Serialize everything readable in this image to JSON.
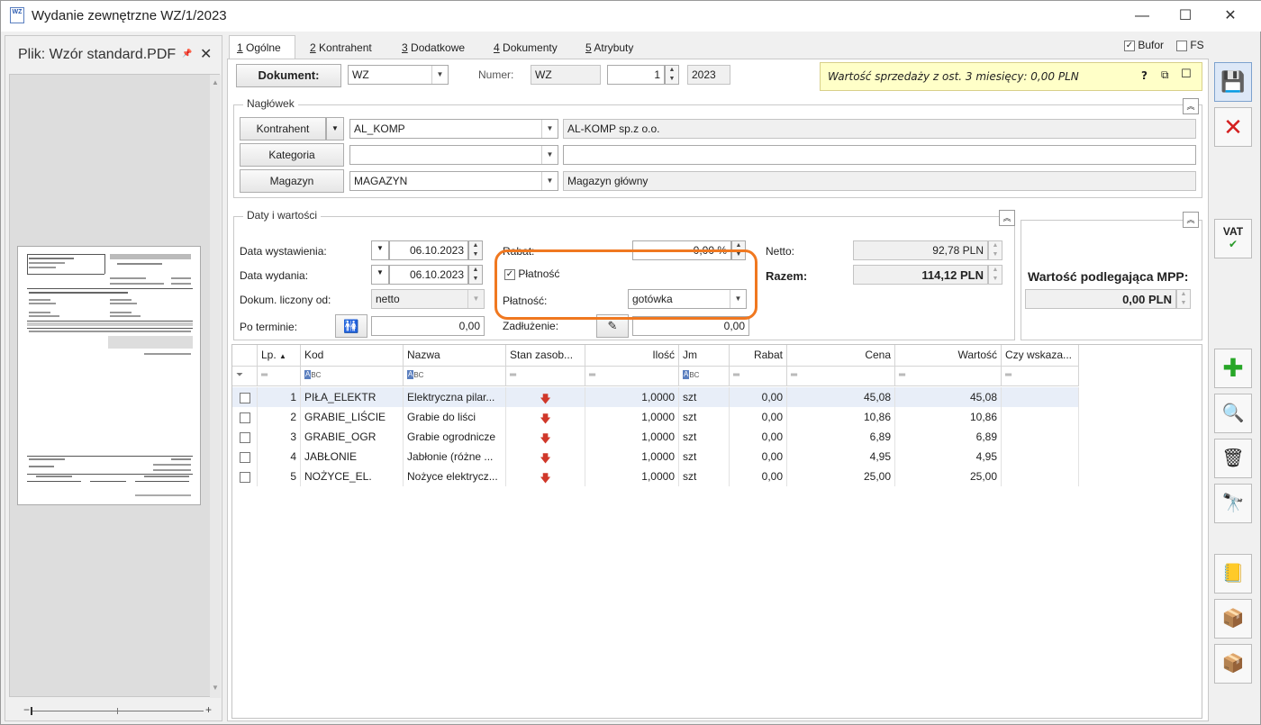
{
  "window": {
    "title": "Wydanie zewnętrzne WZ/1/2023",
    "app_icon_text": "WZ",
    "minimize": "—",
    "maximize": "☐",
    "close": "✕"
  },
  "preview_pane": {
    "title": "Plik: Wzór standard.PDF",
    "pin": "📌",
    "close": "✕",
    "zoom_minus": "−",
    "zoom_plus": "+"
  },
  "tabs": [
    {
      "key": "1",
      "label": "Ogólne"
    },
    {
      "key": "2",
      "label": "Kontrahent"
    },
    {
      "key": "3",
      "label": "Dodatkowe"
    },
    {
      "key": "4",
      "label": "Dokumenty"
    },
    {
      "key": "5",
      "label": "Atrybuty"
    }
  ],
  "flags": {
    "bufor_label": "Bufor",
    "bufor_checked": true,
    "fs_label": "FS",
    "fs_checked": false
  },
  "document": {
    "button_label": "Dokument:",
    "type": "WZ",
    "numer_label": "Numer:",
    "numer_prefix": "WZ",
    "numer_value": "1",
    "year": "2023"
  },
  "sales_note": {
    "text": "Wartość sprzedaży z ost. 3 miesięcy: 0,00 PLN",
    "help": "?"
  },
  "naglowek": {
    "title": "Nagłówek",
    "kontrahent_btn": "Kontrahent",
    "kontrahent_code": "AL_KOMP",
    "kontrahent_name": "AL-KOMP sp.z o.o.",
    "kategoria_btn": "Kategoria",
    "kategoria_code": "",
    "kategoria_name": "",
    "magazyn_btn": "Magazyn",
    "magazyn_code": "MAGAZYN",
    "magazyn_name": "Magazyn główny"
  },
  "daty": {
    "title": "Daty i wartości",
    "data_wystawienia_label": "Data wystawienia:",
    "data_wystawienia": "06.10.2023",
    "data_wydania_label": "Data wydania:",
    "data_wydania": "06.10.2023",
    "liczony_od_label": "Dokum. liczony od:",
    "liczony_od": "netto",
    "po_terminie_label": "Po terminie:",
    "po_terminie": "0,00",
    "rabat_label": "Rabat:",
    "rabat": "0,00 %",
    "platnosc_check_label": "Płatność",
    "platnosc_checked": true,
    "platnosc_label": "Płatność:",
    "platnosc": "gotówka",
    "zadluzenie_label": "Zadłużenie:",
    "zadluzenie": "0,00",
    "netto_label": "Netto:",
    "netto": "92,78 PLN",
    "razem_label": "Razem:",
    "razem": "114,12 PLN"
  },
  "mpp": {
    "label": "Wartość podlegająca MPP:",
    "value": "0,00 PLN"
  },
  "grid": {
    "columns": [
      "Lp.",
      "Kod",
      "Nazwa",
      "Stan zasob...",
      "Ilość",
      "Jm",
      "Rabat",
      "Cena",
      "Wartość",
      "Czy wskaza..."
    ],
    "rows": [
      {
        "lp": "1",
        "kod": "PIŁA_ELEKTR",
        "nazwa": "Elektryczna pilar...",
        "ilosc": "1,0000",
        "jm": "szt",
        "rabat": "0,00",
        "cena": "45,08",
        "wartosc": "45,08"
      },
      {
        "lp": "2",
        "kod": "GRABIE_LIŚCIE",
        "nazwa": "Grabie do liści",
        "ilosc": "1,0000",
        "jm": "szt",
        "rabat": "0,00",
        "cena": "10,86",
        "wartosc": "10,86"
      },
      {
        "lp": "3",
        "kod": "GRABIE_OGR",
        "nazwa": "Grabie ogrodnicze",
        "ilosc": "1,0000",
        "jm": "szt",
        "rabat": "0,00",
        "cena": "6,89",
        "wartosc": "6,89"
      },
      {
        "lp": "4",
        "kod": "JABŁONIE",
        "nazwa": "Jabłonie (różne ...",
        "ilosc": "1,0000",
        "jm": "szt",
        "rabat": "0,00",
        "cena": "4,95",
        "wartosc": "4,95"
      },
      {
        "lp": "5",
        "kod": "NOŻYCE_EL.",
        "nazwa": "Nożyce elektrycz...",
        "ilosc": "1,0000",
        "jm": "szt",
        "rabat": "0,00",
        "cena": "25,00",
        "wartosc": "25,00"
      }
    ]
  },
  "toolbar": {
    "vat_label": "VAT"
  },
  "colors": {
    "highlight": "#f07820",
    "note_bg": "#ffffc8",
    "selected_row": "#e8eef8"
  }
}
